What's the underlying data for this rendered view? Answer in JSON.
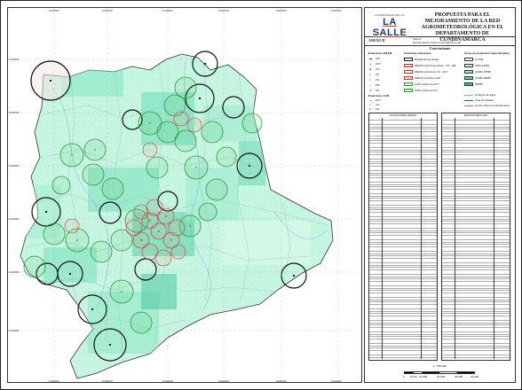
{
  "header": {
    "logo_small": "UNIVERSIDAD DE LA",
    "logo": "LA SALLE",
    "title": "PROPUESTA PARA EL MEJORAMIENTO DE LA RED AGROMETEOROLÓGICA EN EL DEPARTAMENTO DE CUNDINAMARCA",
    "anexo": "ANEXO D",
    "mapa_line1": "Mapa 8",
    "mapa_line2": "Red agrometeorológica actual IDEAM-CAR"
  },
  "legend": {
    "title": "Convenciones",
    "col1_head": "Estaciones IDEAM",
    "col1_items": [
      "AM",
      "ACT",
      "CO",
      "CP",
      "PG",
      "PM",
      "SP"
    ],
    "car_head": "Estaciones CAR",
    "car_items": [
      "ACT",
      "CO",
      "LM"
    ],
    "col2_head": "Cobertura estaciones",
    "col2_items": [
      "Resoluciones actual",
      "IDEAM Cobertura actual - CP - AM",
      "IDEAM Cobertura CO - ACT",
      "IDEAM Cobertura AM",
      "CAR Cobertura ACT",
      "CAR Cobertura CO"
    ],
    "col3_head": "Áreas de producción agrícola (Has)",
    "col3_items": [
      "0-7584",
      "7584-14300",
      "14300-27586",
      "27586-36585",
      "36585-"
    ],
    "lines": [
      "Cuerpos de agua",
      "Vías principales",
      "Límite urbano Cundinamarca"
    ]
  },
  "table": {
    "head_left": "ESTACIONES IDEAM",
    "head_right": "ESTACIONES CAR"
  },
  "scale": {
    "label": "1 : 950.000",
    "ticks": [
      "0",
      "5.000",
      "10.000",
      "20.000",
      "30.000",
      "40.000"
    ]
  },
  "grid": {
    "top": [
      "1000000",
      "1020000",
      "1040000",
      "1060000",
      "1080000",
      "1100000"
    ],
    "left": [
      "1100000",
      "1080000",
      "1060000",
      "1040000",
      "1020000",
      "1000000"
    ]
  },
  "colors": {
    "map_light": "#bdf3dc",
    "map_mid": "#7fe3c0",
    "map_dark": "#40c49a",
    "circle_green": "#2f9a3a",
    "circle_red": "#d32f2f",
    "circle_black": "#111111"
  }
}
